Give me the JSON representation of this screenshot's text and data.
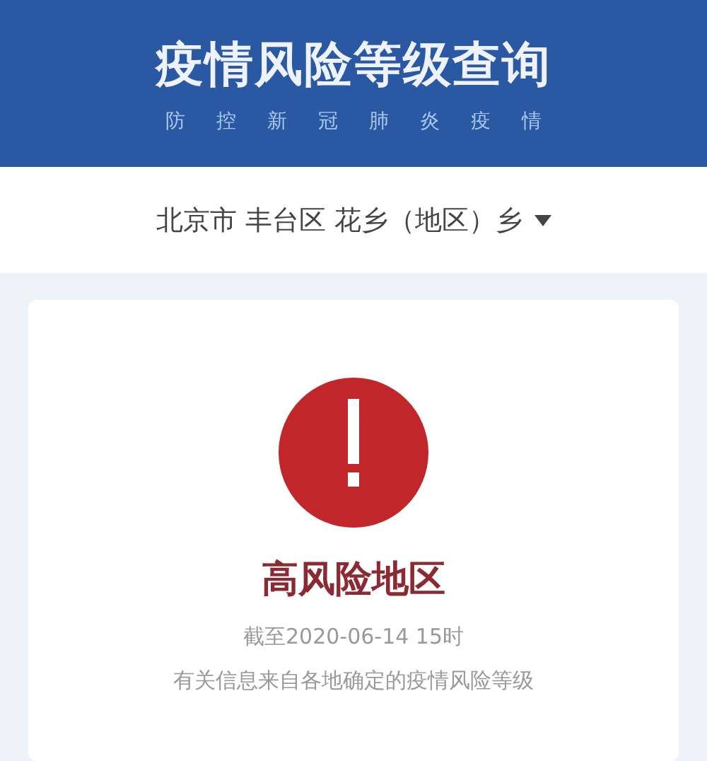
{
  "header": {
    "title": "疫情风险等级查询",
    "subtitle": "防控新冠肺炎疫情"
  },
  "location": {
    "value": "北京市 丰台区 花乡（地区）乡"
  },
  "result": {
    "label": "高风险地区",
    "updated": "截至2020-06-14 15时",
    "note": "有关信息来自各地确定的疫情风险等级"
  }
}
